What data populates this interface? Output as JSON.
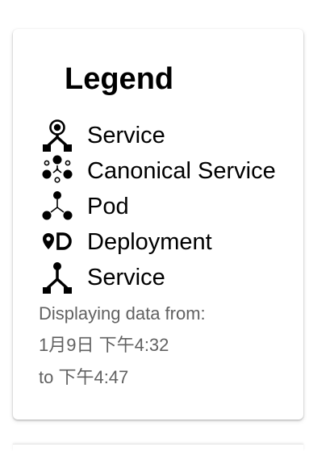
{
  "legend": {
    "title": "Legend",
    "items": [
      {
        "icon": "service-icon",
        "label": "Service"
      },
      {
        "icon": "canonical-service-icon",
        "label": "Canonical Service"
      },
      {
        "icon": "pod-icon",
        "label": "Pod"
      },
      {
        "icon": "deployment-icon",
        "label": "Deployment"
      },
      {
        "icon": "service-entry-icon",
        "label": "Service"
      }
    ],
    "time_range": {
      "intro": "Displaying data from:",
      "from": "1月9日 下午4:32",
      "to": "to 下午4:47"
    }
  }
}
